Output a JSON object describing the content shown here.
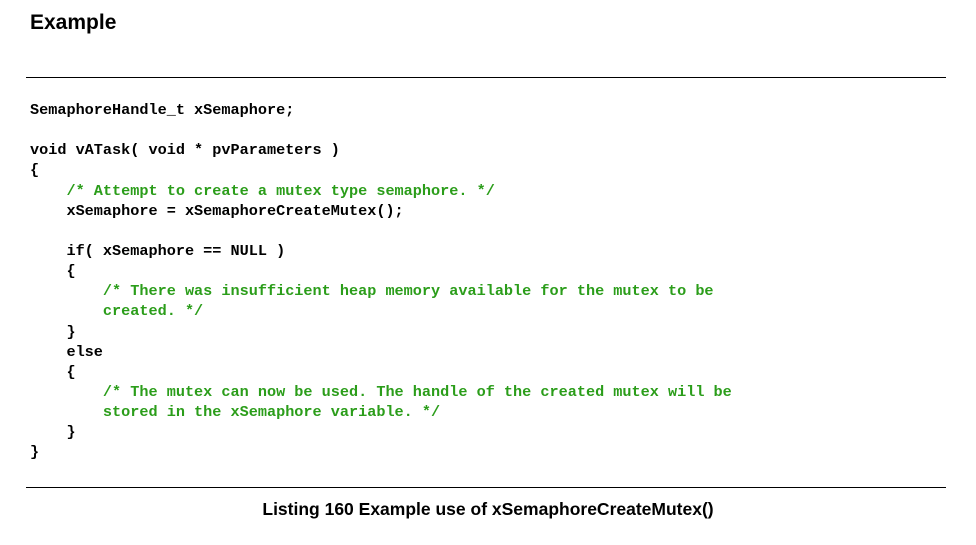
{
  "section_title": "Example",
  "colors": {
    "code": "#000000",
    "comment": "#2b9d1a"
  },
  "code_lines": [
    {
      "text": "SemaphoreHandle_t xSemaphore;",
      "kind": "code"
    },
    {
      "text": "",
      "kind": "code"
    },
    {
      "text": "void vATask( void * pvParameters )",
      "kind": "code"
    },
    {
      "text": "{",
      "kind": "code"
    },
    {
      "text": "    /* Attempt to create a mutex type semaphore. */",
      "kind": "comment"
    },
    {
      "text": "    xSemaphore = xSemaphoreCreateMutex();",
      "kind": "code"
    },
    {
      "text": "",
      "kind": "code"
    },
    {
      "text": "    if( xSemaphore == NULL )",
      "kind": "code"
    },
    {
      "text": "    {",
      "kind": "code"
    },
    {
      "text": "        /* There was insufficient heap memory available for the mutex to be",
      "kind": "comment"
    },
    {
      "text": "        created. */",
      "kind": "comment"
    },
    {
      "text": "    }",
      "kind": "code"
    },
    {
      "text": "    else",
      "kind": "code"
    },
    {
      "text": "    {",
      "kind": "code"
    },
    {
      "text": "        /* The mutex can now be used. The handle of the created mutex will be",
      "kind": "comment"
    },
    {
      "text": "        stored in the xSemaphore variable. */",
      "kind": "comment"
    },
    {
      "text": "    }",
      "kind": "code"
    },
    {
      "text": "}",
      "kind": "code"
    }
  ],
  "caption": "Listing 160 Example use of xSemaphoreCreateMutex()"
}
